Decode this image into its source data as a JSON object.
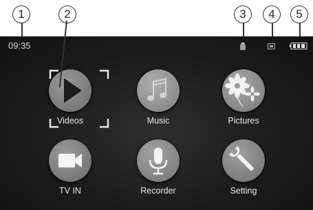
{
  "callouts": [
    "1",
    "2",
    "3",
    "4",
    "5"
  ],
  "status_bar": {
    "time": "09:35",
    "icons": [
      "usb-icon",
      "memory-card-icon",
      "battery-icon"
    ]
  },
  "menu": {
    "items": [
      {
        "label": "Videos",
        "icon": "play-icon",
        "selected": true
      },
      {
        "label": "Music",
        "icon": "music-note-icon",
        "selected": false
      },
      {
        "label": "Pictures",
        "icon": "flower-icon",
        "selected": false
      },
      {
        "label": "TV IN",
        "icon": "video-camera-icon",
        "selected": false
      },
      {
        "label": "Recorder",
        "icon": "microphone-icon",
        "selected": false
      },
      {
        "label": "Setting",
        "icon": "wrench-icon",
        "selected": false
      }
    ]
  },
  "colors": {
    "screen_background": "#1a1a1a",
    "label_text": "#e8e8e8",
    "icon_gray": "#8a8a8a"
  }
}
